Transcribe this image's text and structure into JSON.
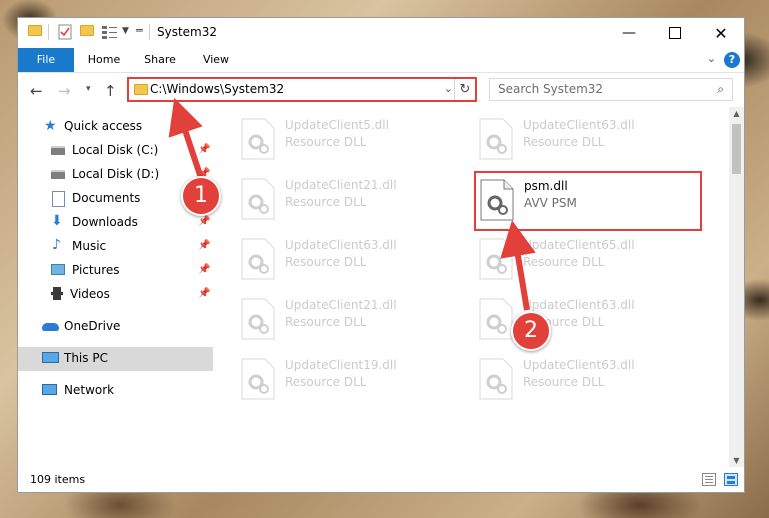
{
  "window": {
    "title": "System32",
    "minimize_icon": "minimize-icon",
    "maximize_icon": "maximize-icon",
    "close_icon": "close-icon"
  },
  "ribbon": {
    "tabs": [
      "File",
      "Home",
      "Share",
      "View"
    ],
    "help_label": "?"
  },
  "address_bar": {
    "path": "C:\\Windows\\System32"
  },
  "search": {
    "placeholder": "Search System32"
  },
  "nav_pane": {
    "items": [
      {
        "label": "Quick access",
        "icon": "star-icon"
      },
      {
        "label": "Local Disk (C:)",
        "icon": "drive-icon",
        "pinned": true
      },
      {
        "label": "Local Disk (D:)",
        "icon": "drive-icon",
        "pinned": true
      },
      {
        "label": "Documents",
        "icon": "documents-icon",
        "pinned": true
      },
      {
        "label": "Downloads",
        "icon": "download-icon",
        "pinned": true
      },
      {
        "label": "Music",
        "icon": "music-icon",
        "pinned": true
      },
      {
        "label": "Pictures",
        "icon": "pictures-icon",
        "pinned": true
      },
      {
        "label": "Videos",
        "icon": "videos-icon",
        "pinned": true
      },
      {
        "label": "OneDrive",
        "icon": "cloud-icon"
      },
      {
        "label": "This PC",
        "icon": "computer-icon",
        "selected": true
      },
      {
        "label": "Network",
        "icon": "network-icon"
      }
    ]
  },
  "files": [
    {
      "name": "UpdateClient5.dll",
      "type": "Resource DLL"
    },
    {
      "name": "UpdateClient63.dll",
      "type": "Resource DLL"
    },
    {
      "name": "UpdateClient21.dll",
      "type": "Resource DLL"
    },
    {
      "name": "psm.dll",
      "type": "AVV PSM"
    },
    {
      "name": "UpdateClient63.dll",
      "type": "Resource DLL"
    },
    {
      "name": "UpdateClient65.dll",
      "type": "Resource DLL"
    },
    {
      "name": "UpdateClient21.dll",
      "type": "Resource DLL"
    },
    {
      "name": "UpdateClient63.dll",
      "type": "Resource DLL"
    },
    {
      "name": "UpdateClient19.dll",
      "type": "Resource DLL"
    },
    {
      "name": "UpdateClient63.dll",
      "type": "Resource DLL"
    }
  ],
  "status_bar": {
    "item_count": "109 items"
  },
  "annotations": {
    "step1": "1",
    "step2": "2",
    "color": "#e2403a"
  }
}
